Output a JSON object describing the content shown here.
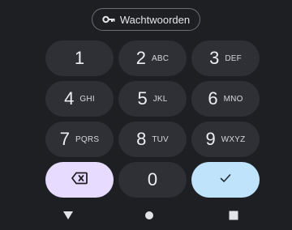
{
  "suggestion_bar": {
    "passwords_chip": {
      "label": "Wachtwoorden",
      "icon": "key-icon"
    }
  },
  "keypad": {
    "keys": [
      {
        "digit": "1",
        "letters": ""
      },
      {
        "digit": "2",
        "letters": "ABC"
      },
      {
        "digit": "3",
        "letters": "DEF"
      },
      {
        "digit": "4",
        "letters": "GHI"
      },
      {
        "digit": "5",
        "letters": "JKL"
      },
      {
        "digit": "6",
        "letters": "MNO"
      },
      {
        "digit": "7",
        "letters": "PQRS"
      },
      {
        "digit": "8",
        "letters": "TUV"
      },
      {
        "digit": "9",
        "letters": "WXYZ"
      }
    ],
    "zero": {
      "digit": "0"
    },
    "backspace": {
      "icon": "backspace-icon",
      "color": "#e7dcff"
    },
    "confirm": {
      "icon": "checkmark-icon",
      "color": "#bfe3fb"
    }
  },
  "navigation_bar": {
    "back": {
      "icon": "back-triangle-icon"
    },
    "home": {
      "icon": "home-circle-icon"
    },
    "recents": {
      "icon": "recents-square-icon"
    }
  }
}
